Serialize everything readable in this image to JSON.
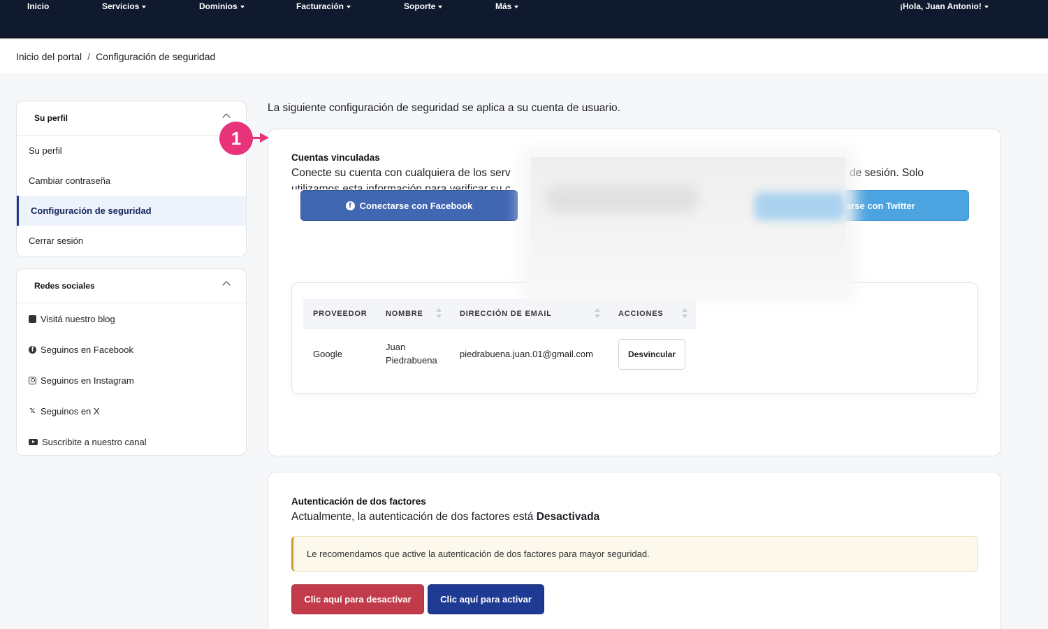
{
  "topnav": {
    "items": [
      "Inicio",
      "Servicios",
      "Dominios",
      "Facturación",
      "Soporte",
      "Más"
    ],
    "user_greeting": "¡Hola, Juan Antonio!",
    "background": "#0f1a2e"
  },
  "breadcrumb": {
    "home": "Inicio del portal",
    "separator": "/",
    "current": "Configuración de seguridad"
  },
  "profile_panel": {
    "title": "Su perfil",
    "items": [
      "Su perfil",
      "Cambiar contraseña",
      "Configuración de seguridad",
      "Cerrar sesión"
    ],
    "active_index": 2
  },
  "social_panel": {
    "title": "Redes sociales",
    "items": [
      {
        "label": "Visitá nuestro blog",
        "icon": "blog-icon"
      },
      {
        "label": "Seguinos en Facebook",
        "icon": "facebook-icon"
      },
      {
        "label": "Seguinos en Instagram",
        "icon": "instagram-icon"
      },
      {
        "label": "Seguinos en X",
        "icon": "x-icon"
      },
      {
        "label": "Suscribite a nuestro canal",
        "icon": "youtube-icon"
      }
    ]
  },
  "main": {
    "intro": "La siguiente configuración de seguridad se aplica a su cuenta de usuario.",
    "linked_accounts": {
      "title": "Cuentas vinculadas",
      "desc_line1_left": "Conecte su cuenta con cualquiera de los serv",
      "desc_line1_right": "de sesión. Solo",
      "desc_line2": "utilizamos esta información para verificar su c",
      "facebook_button": "Conectarse con Facebook",
      "twitter_button": "arse con Twitter",
      "table": {
        "headers": [
          "PROVEEDOR",
          "NOMBRE",
          "DIRECCIÓN DE EMAIL",
          "ACCIONES"
        ],
        "rows": [
          {
            "provider": "Google",
            "name_line1": "Juan",
            "name_line2": "Piedrabuena",
            "email": "piedrabuena.juan.01@gmail.com",
            "action": "Desvincular"
          }
        ]
      }
    },
    "two_factor": {
      "title": "Autenticación de dos factores",
      "status_prefix": "Actualmente, la autenticación de dos factores está",
      "status_value": "Desactivada",
      "alert": "Le recomendamos que active la autenticación de dos factores para mayor seguridad.",
      "deactivate_button": "Clic aquí para desactivar",
      "activate_button": "Clic aquí para activar"
    }
  },
  "callout_number": "1",
  "colors": {
    "accent_blue": "#1f3a93",
    "facebook": "#4267b2",
    "twitter": "#4ba3e0",
    "danger": "#c23b4a",
    "callout": "#e8337a"
  }
}
